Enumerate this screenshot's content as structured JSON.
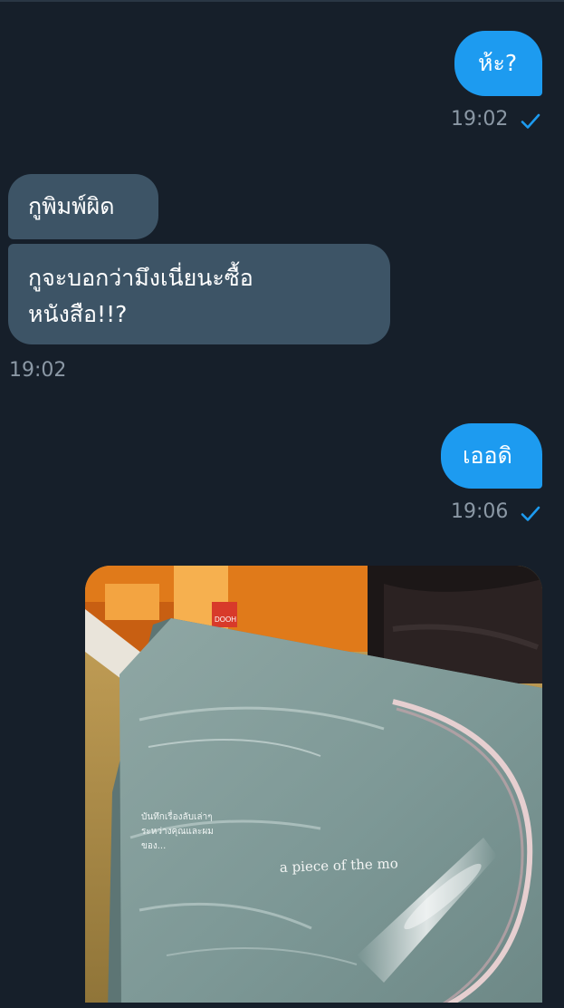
{
  "messages": {
    "m1": {
      "text": "ห้ะ?",
      "time": "19:02",
      "status": "check-icon"
    },
    "m2": {
      "text": "กูพิมพ์ผิด"
    },
    "m3": {
      "line1": "กูจะบอกว่ามึงเนี่ยนะซื้อ",
      "line2": "หนังสือ!!?",
      "time": "19:02"
    },
    "m4": {
      "text": "เออดิ",
      "time": "19:06",
      "status": "check-icon"
    }
  },
  "photo": {
    "caption": "a piece of the mo",
    "subtitle_lines": [
      "บันทึกเรื่องลับเล่าๆ",
      "ระหว่างคุณและผม",
      "ของ..."
    ],
    "sticker": "DOOH"
  },
  "colors": {
    "background": "#161f2a",
    "outgoing": "#1d9bf0",
    "incoming": "#3d5466",
    "timestamp": "#8b98a5"
  }
}
